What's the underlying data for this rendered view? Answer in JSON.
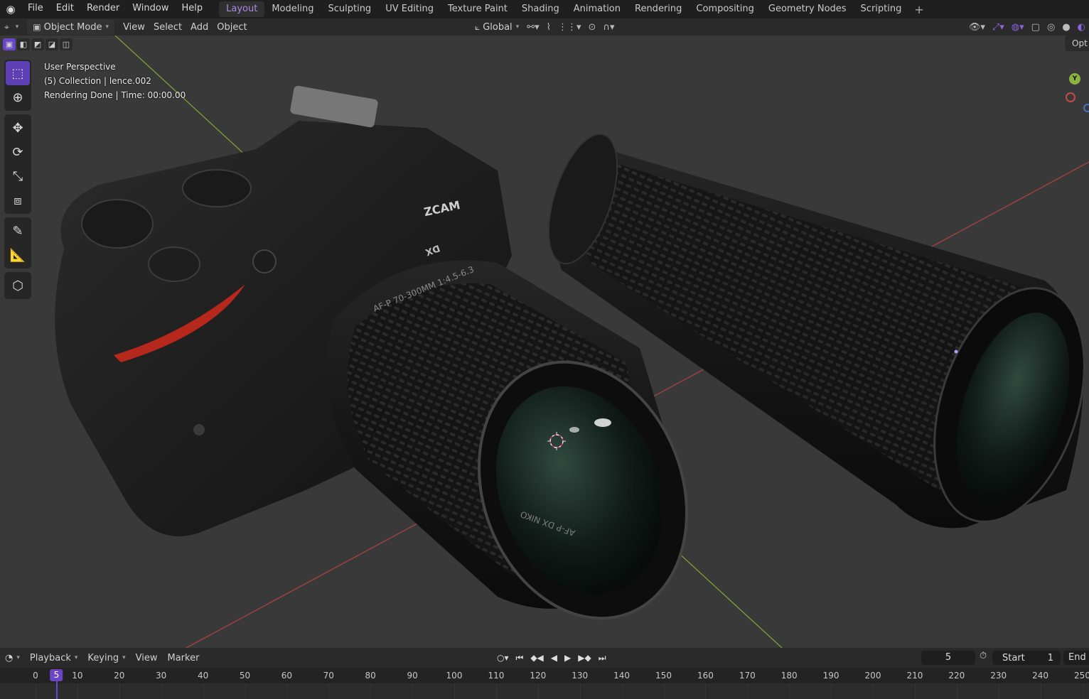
{
  "app": {
    "menu": [
      "File",
      "Edit",
      "Render",
      "Window",
      "Help"
    ],
    "workspaces": [
      "Layout",
      "Modeling",
      "Sculpting",
      "UV Editing",
      "Texture Paint",
      "Shading",
      "Animation",
      "Rendering",
      "Compositing",
      "Geometry Nodes",
      "Scripting"
    ],
    "active_workspace": "Layout",
    "add_workspace": "+"
  },
  "viewport_header": {
    "mode": "Object Mode",
    "menus": [
      "View",
      "Select",
      "Add",
      "Object"
    ],
    "transform_orientation": "Global"
  },
  "viewport": {
    "info_lines": [
      "User Perspective",
      "(5) Collection | lence.002",
      "Rendering Done | Time: 00:00.00"
    ],
    "options_tab": "Opt",
    "gizmo_y": "Y",
    "camera_brand": "ZCAM",
    "lens_badge": "DX",
    "lens_text": "AF-P 70-300MM 1:4.5-6.3",
    "lens_front_text": "AF-P DX NIKO"
  },
  "colors": {
    "accent": "#6a46c6",
    "workspace_active": "#a98be5",
    "axis_x": "#a8443f",
    "axis_y": "#7f9f37",
    "grip_red": "#b7281c"
  },
  "timeline": {
    "menus": [
      "Playback",
      "Keying",
      "View",
      "Marker"
    ],
    "current_frame": "5",
    "start_label": "Start",
    "start_value": "1",
    "end_label": "End",
    "ruler": [
      "0",
      "10",
      "20",
      "30",
      "40",
      "50",
      "60",
      "70",
      "80",
      "90",
      "100",
      "110",
      "120",
      "130",
      "140",
      "150",
      "160",
      "170",
      "180",
      "190",
      "200",
      "210",
      "220",
      "230",
      "240",
      "250"
    ]
  }
}
